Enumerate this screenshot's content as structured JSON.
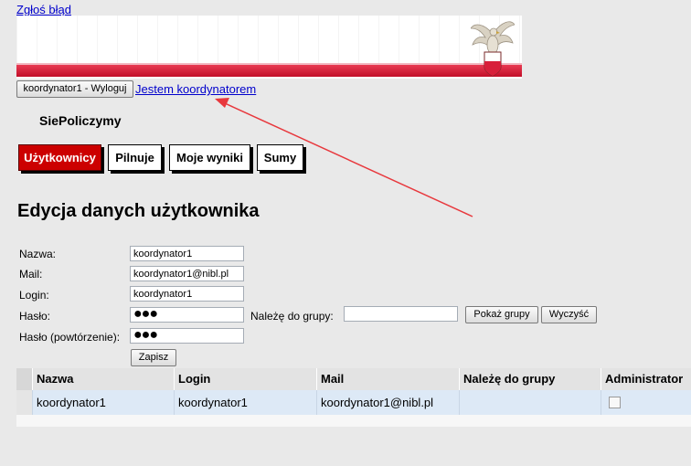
{
  "links": {
    "report_bug": "Zgłoś błąd",
    "coordinator": "Jestem koordynatorem"
  },
  "header": {
    "logout_label": "koordynator1 - Wyloguj",
    "app_name": "SiePoliczymy"
  },
  "tabs": [
    {
      "label": "Użytkownicy",
      "active": true
    },
    {
      "label": "Pilnuje",
      "active": false
    },
    {
      "label": "Moje wyniki",
      "active": false
    },
    {
      "label": "Sumy",
      "active": false
    }
  ],
  "page_title": "Edycja danych użytkownika",
  "form": {
    "name_label": "Nazwa:",
    "name_value": "koordynator1",
    "mail_label": "Mail:",
    "mail_value": "koordynator1@nibl.pl",
    "login_label": "Login:",
    "login_value": "koordynator1",
    "password_label": "Hasło:",
    "password_value": "●●●",
    "group_label": "Należę do grupy:",
    "group_value": "",
    "show_groups_label": "Pokaż grupy",
    "clear_label": "Wyczyść",
    "password_repeat_label": "Hasło (powtórzenie):",
    "password_repeat_value": "●●●",
    "save_label": "Zapisz"
  },
  "table": {
    "columns": [
      "Nazwa",
      "Login",
      "Mail",
      "Należę do grupy",
      "Administrator"
    ],
    "rows": [
      {
        "nazwa": "koordynator1",
        "login": "koordynator1",
        "mail": "koordynator1@nibl.pl",
        "grupa": "",
        "administrator": false
      }
    ]
  },
  "colors": {
    "accent_red": "#cc0000",
    "banner_stripe": "#d81f3a",
    "annotation_arrow": "#e8383d",
    "selected_row": "#dde9f6"
  }
}
